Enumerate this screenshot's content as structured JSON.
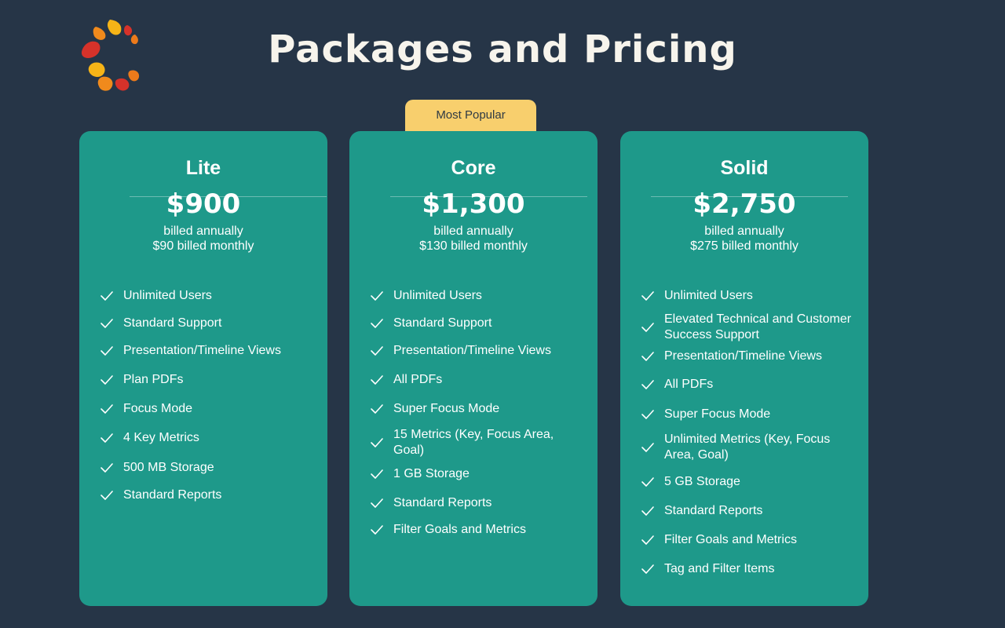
{
  "header": {
    "title": "Packages and Pricing",
    "logo_icon": "swirl-logo-icon"
  },
  "badge": {
    "label": "Most Popular"
  },
  "plans": [
    {
      "name": "Lite",
      "price": "$900",
      "billing_line1": "billed annually",
      "billing_line2": "$90 billed monthly",
      "features": [
        "Unlimited Users",
        "Standard Support",
        "Presentation/Timeline Views",
        "Plan PDFs",
        "Focus Mode",
        "4 Key Metrics",
        "500 MB Storage",
        "Standard Reports"
      ]
    },
    {
      "name": "Core",
      "price": "$1,300",
      "billing_line1": "billed annually",
      "billing_line2": "$130 billed monthly",
      "features": [
        "Unlimited Users",
        "Standard Support",
        "Presentation/Timeline Views",
        "All PDFs",
        "Super Focus Mode",
        "15 Metrics (Key, Focus Area, Goal)",
        "1 GB Storage",
        "Standard Reports",
        "Filter Goals and Metrics"
      ]
    },
    {
      "name": "Solid",
      "price": "$2,750",
      "billing_line1": "billed annually",
      "billing_line2": "$275 billed monthly",
      "features": [
        "Unlimited Users",
        "Elevated Technical and Customer Success Support",
        "Presentation/Timeline Views",
        "All PDFs",
        "Super Focus Mode",
        "Unlimited Metrics (Key, Focus Area, Goal)",
        "5 GB Storage",
        "Standard Reports",
        "Filter Goals and Metrics",
        "Tag and Filter Items"
      ]
    }
  ],
  "colors": {
    "background": "#263547",
    "card": "#1e998a",
    "badge": "#f8cf6d",
    "title": "#f7f4ec"
  }
}
